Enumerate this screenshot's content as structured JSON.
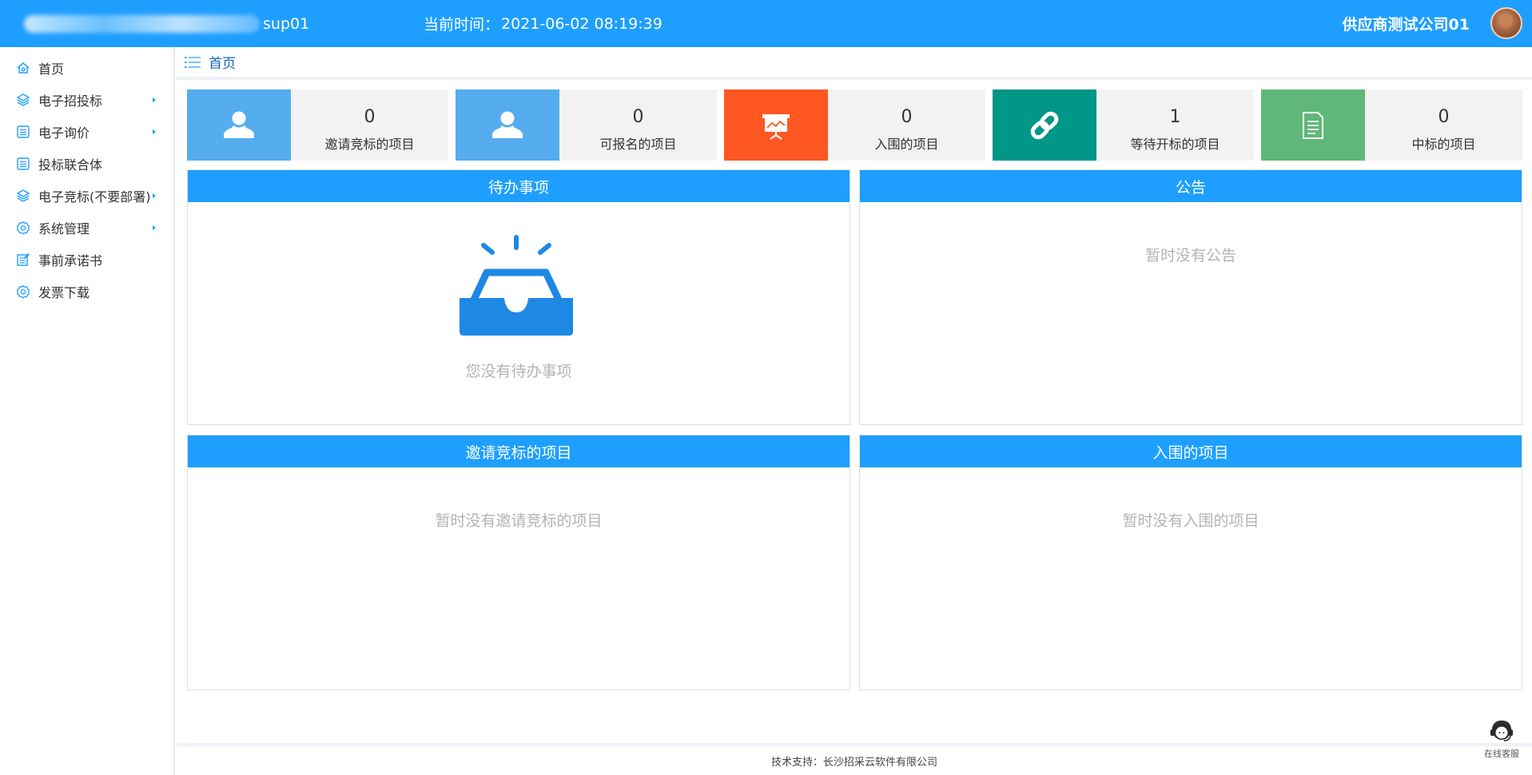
{
  "header": {
    "system_user": "sup01",
    "clock_label": "当前时间：",
    "clock_value": "2021-06-02 08:19:39",
    "company": "供应商测试公司01",
    "bg_color": "#1e9fff"
  },
  "sidebar": {
    "items": [
      {
        "label": "首页",
        "icon": "home-icon",
        "has_submenu": false
      },
      {
        "label": "电子招投标",
        "icon": "layers-icon",
        "has_submenu": true
      },
      {
        "label": "电子询价",
        "icon": "list-icon",
        "has_submenu": true
      },
      {
        "label": "投标联合体",
        "icon": "list-icon",
        "has_submenu": false
      },
      {
        "label": "电子竞标(不要部署)",
        "icon": "layers-icon",
        "has_submenu": true
      },
      {
        "label": "系统管理",
        "icon": "gear-icon",
        "has_submenu": true
      },
      {
        "label": "事前承诺书",
        "icon": "edit-doc-icon",
        "has_submenu": false
      },
      {
        "label": "发票下载",
        "icon": "gear-icon",
        "has_submenu": false
      }
    ]
  },
  "breadcrumb": {
    "current": "首页"
  },
  "stats": [
    {
      "value": "0",
      "label": "邀请竞标的项目",
      "color": "#55acee",
      "icon": "user-icon"
    },
    {
      "value": "0",
      "label": "可报名的项目",
      "color": "#55acee",
      "icon": "user-icon"
    },
    {
      "value": "0",
      "label": "入围的项目",
      "color": "#ff5722",
      "icon": "presentation-icon"
    },
    {
      "value": "1",
      "label": "等待开标的项目",
      "color": "#009688",
      "icon": "link-icon"
    },
    {
      "value": "0",
      "label": "中标的项目",
      "color": "#5fb878",
      "icon": "document-icon"
    }
  ],
  "panels": {
    "todo": {
      "title": "待办事项",
      "empty": "您没有待办事项"
    },
    "notice": {
      "title": "公告",
      "empty": "暂时没有公告"
    },
    "invited": {
      "title": "邀请竞标的项目",
      "empty": "暂时没有邀请竞标的项目"
    },
    "shortlisted": {
      "title": "入围的项目",
      "empty": "暂时没有入围的项目"
    }
  },
  "footer": {
    "text": "技术支持：长沙招采云软件有限公司"
  },
  "service": {
    "label": "在线客服"
  }
}
